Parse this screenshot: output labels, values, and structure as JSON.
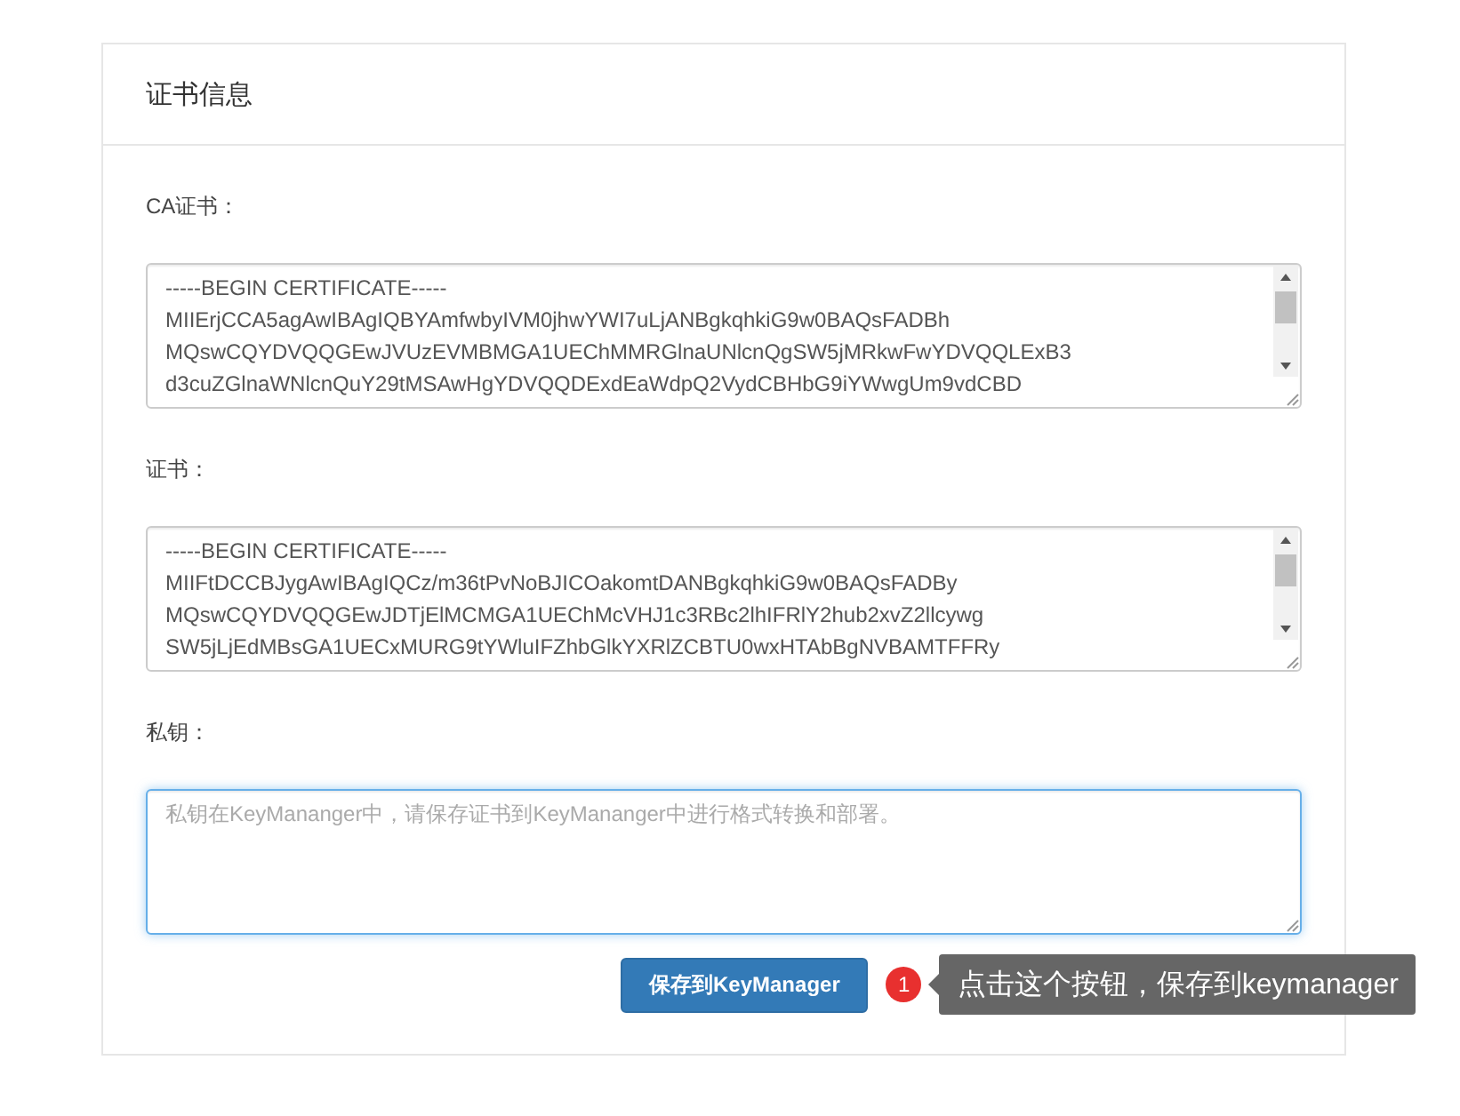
{
  "panel": {
    "title": "证书信息"
  },
  "fields": [
    {
      "kind": "certificate",
      "label": "CA证书：",
      "value": "-----BEGIN CERTIFICATE-----\nMIIErjCCA5agAwIBAgIQBYAmfwbyIVM0jhwYWI7uLjANBgkqhkiG9w0BAQsFADBh\nMQswCQYDVQQGEwJVUzEVMBMGA1UEChMMRGlnaUNlcnQgSW5jMRkwFwYDVQQLExB3\nd3cuZGlnaWNlcnQuY29tMSAwHgYDVQQDExdEaWdpQ2VydCBHbG9iYWwgUm9vdCBD"
    },
    {
      "kind": "certificate",
      "label": "证书：",
      "value": "-----BEGIN CERTIFICATE-----\nMIIFtDCCBJygAwIBAgIQCz/m36tPvNoBJICOakomtDANBgkqhkiG9w0BAQsFADBy\nMQswCQYDVQQGEwJDTjElMCMGA1UEChMcVHJ1c3RBc2lhIFRlY2hub2xvZ2llcywg\nSW5jLjEdMBsGA1UECxMURG9tYWluIFZhbGlkYXRlZCBTU0wxHTAbBgNVBAMTFFRy"
    },
    {
      "kind": "private_key",
      "label": "私钥：",
      "placeholder": "私钥在KeyMananger中，请保存证书到KeyMananger中进行格式转换和部署。",
      "focused": true
    }
  ],
  "save_button": "保存到KeyManager",
  "hint": {
    "badge": "1",
    "text": "点击这个按钮，保存到keymanager"
  }
}
